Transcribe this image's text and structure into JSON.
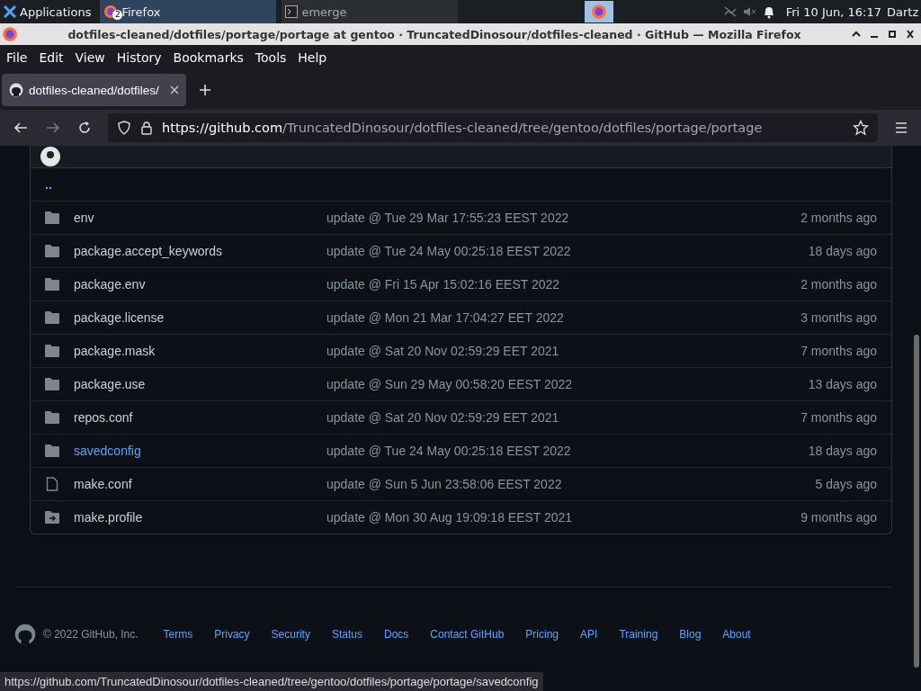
{
  "taskbar": {
    "apps_label": "Applications",
    "tasks": [
      {
        "label": "Firefox",
        "badge": "2",
        "selected": true,
        "kind": "browser"
      },
      {
        "label": "emerge",
        "selected": false,
        "kind": "terminal"
      }
    ],
    "clock": "Fri 10 Jun, 16:17",
    "user": "Dartz"
  },
  "window": {
    "title": "dotfiles-cleaned/dotfiles/portage/portage at gentoo · TruncatedDinosour/dotfiles-cleaned · GitHub — Mozilla Firefox"
  },
  "menu": [
    "File",
    "Edit",
    "View",
    "History",
    "Bookmarks",
    "Tools",
    "Help"
  ],
  "tab": {
    "title": "dotfiles-cleaned/dotfiles/"
  },
  "address": {
    "host": "https://github.com",
    "path": "/TruncatedDinosour/dotfiles-cleaned/tree/gentoo/dotfiles/portage/portage"
  },
  "parent_link": "..",
  "rows": [
    {
      "kind": "dir",
      "name": "env",
      "message": "update @ Tue 29 Mar 17:55:23 EEST 2022",
      "age": "2 months ago",
      "hovered": false
    },
    {
      "kind": "dir",
      "name": "package.accept_keywords",
      "message": "update @ Tue 24 May 00:25:18 EEST 2022",
      "age": "18 days ago",
      "hovered": false
    },
    {
      "kind": "dir",
      "name": "package.env",
      "message": "update @ Fri 15 Apr 15:02:16 EEST 2022",
      "age": "2 months ago",
      "hovered": false
    },
    {
      "kind": "dir",
      "name": "package.license",
      "message": "update @ Mon 21 Mar 17:04:27 EET 2022",
      "age": "3 months ago",
      "hovered": false
    },
    {
      "kind": "dir",
      "name": "package.mask",
      "message": "update @ Sat 20 Nov 02:59:29 EET 2021",
      "age": "7 months ago",
      "hovered": false
    },
    {
      "kind": "dir",
      "name": "package.use",
      "message": "update @ Sun 29 May 00:58:20 EEST 2022",
      "age": "13 days ago",
      "hovered": false
    },
    {
      "kind": "dir",
      "name": "repos.conf",
      "message": "update @ Sat 20 Nov 02:59:29 EET 2021",
      "age": "7 months ago",
      "hovered": false
    },
    {
      "kind": "dir",
      "name": "savedconfig",
      "message": "update @ Tue 24 May 00:25:18 EEST 2022",
      "age": "18 days ago",
      "hovered": true
    },
    {
      "kind": "file",
      "name": "make.conf",
      "message": "update @ Sun 5 Jun 23:58:06 EEST 2022",
      "age": "5 days ago",
      "hovered": false
    },
    {
      "kind": "symlink",
      "name": "make.profile",
      "message": "update @ Mon 30 Aug 19:09:18 EEST 2021",
      "age": "9 months ago",
      "hovered": false
    }
  ],
  "footer": {
    "copyright": "© 2022 GitHub, Inc.",
    "links": [
      "Terms",
      "Privacy",
      "Security",
      "Status",
      "Docs",
      "Contact GitHub",
      "Pricing",
      "API",
      "Training",
      "Blog",
      "About"
    ]
  },
  "status_bar": "https://github.com/TruncatedDinosour/dotfiles-cleaned/tree/gentoo/dotfiles/portage/portage/savedconfig"
}
